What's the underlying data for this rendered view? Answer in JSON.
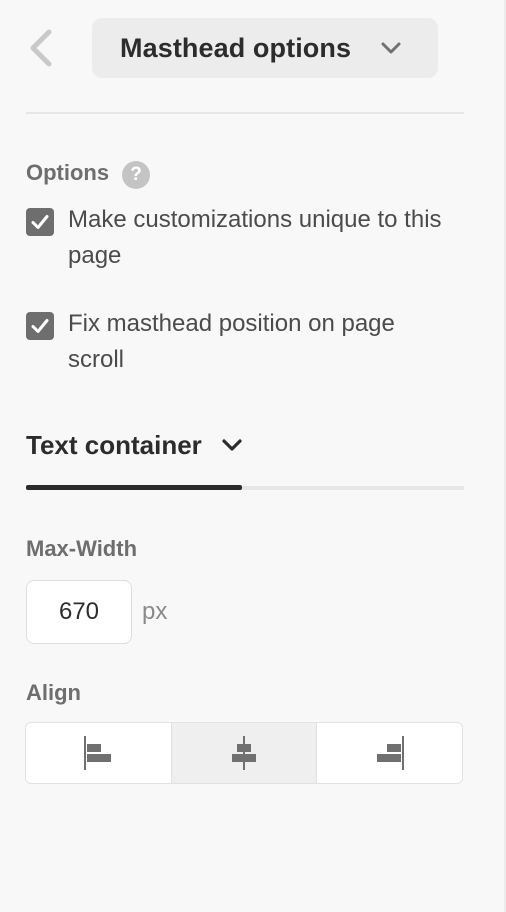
{
  "header": {
    "back_icon": "chevron-left-icon",
    "title": "Masthead options",
    "dropdown_icon": "chevron-down-icon"
  },
  "options": {
    "label": "Options",
    "help_glyph": "?",
    "items": [
      {
        "label": "Make customizations unique to this page",
        "checked": true
      },
      {
        "label": "Fix masthead position on page scroll",
        "checked": true
      }
    ]
  },
  "text_container": {
    "tab_label": "Text container",
    "tab_icon": "chevron-down-icon",
    "max_width": {
      "label": "Max-Width",
      "value": "670",
      "unit": "px"
    },
    "align": {
      "label": "Align",
      "options": [
        {
          "name": "align-left-icon",
          "selected": false
        },
        {
          "name": "align-center-icon",
          "selected": true
        },
        {
          "name": "align-right-icon",
          "selected": false
        }
      ]
    }
  },
  "colors": {
    "panel_bg": "#f8f8f8",
    "text_primary": "#2c2c2c",
    "text_secondary": "#6e6e6e",
    "checkbox_fill": "#6e6e6e",
    "icon_gray": "#707070"
  }
}
